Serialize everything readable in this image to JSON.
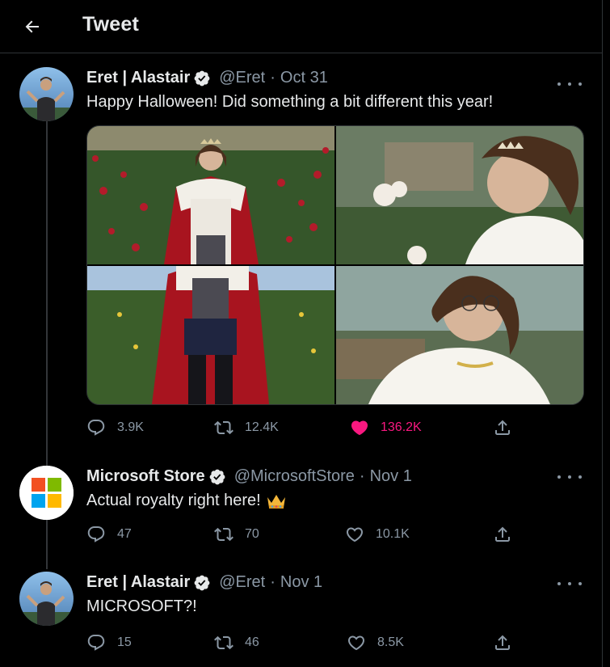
{
  "header": {
    "title": "Tweet"
  },
  "tweets": [
    {
      "name": "Eret | Alastair",
      "handle": "@Eret",
      "date": "Oct 31",
      "text": "Happy Halloween! Did something a bit different this year!",
      "stats": {
        "replies": "3.9K",
        "retweets": "12.4K",
        "likes": "136.2K"
      },
      "liked": true
    },
    {
      "name": "Microsoft Store",
      "handle": "@MicrosoftStore",
      "date": "Nov 1",
      "text": "Actual royalty right here! ",
      "emoji": "crown-emoji",
      "stats": {
        "replies": "47",
        "retweets": "70",
        "likes": "10.1K"
      },
      "liked": false
    },
    {
      "name": "Eret | Alastair",
      "handle": "@Eret",
      "date": "Nov 1",
      "text": "MICROSOFT?!",
      "stats": {
        "replies": "15",
        "retweets": "46",
        "likes": "8.5K"
      },
      "liked": false
    }
  ],
  "colors": {
    "background": "#000000",
    "text_primary": "#e7e9ea",
    "text_secondary": "#8b98a5",
    "like_active": "#f91880",
    "verified": "#e7e9ea",
    "border": "#2f3336"
  },
  "icons": [
    "back-arrow-icon",
    "verified-badge-icon",
    "more-icon",
    "reply-icon",
    "retweet-icon",
    "heart-icon",
    "share-icon"
  ]
}
